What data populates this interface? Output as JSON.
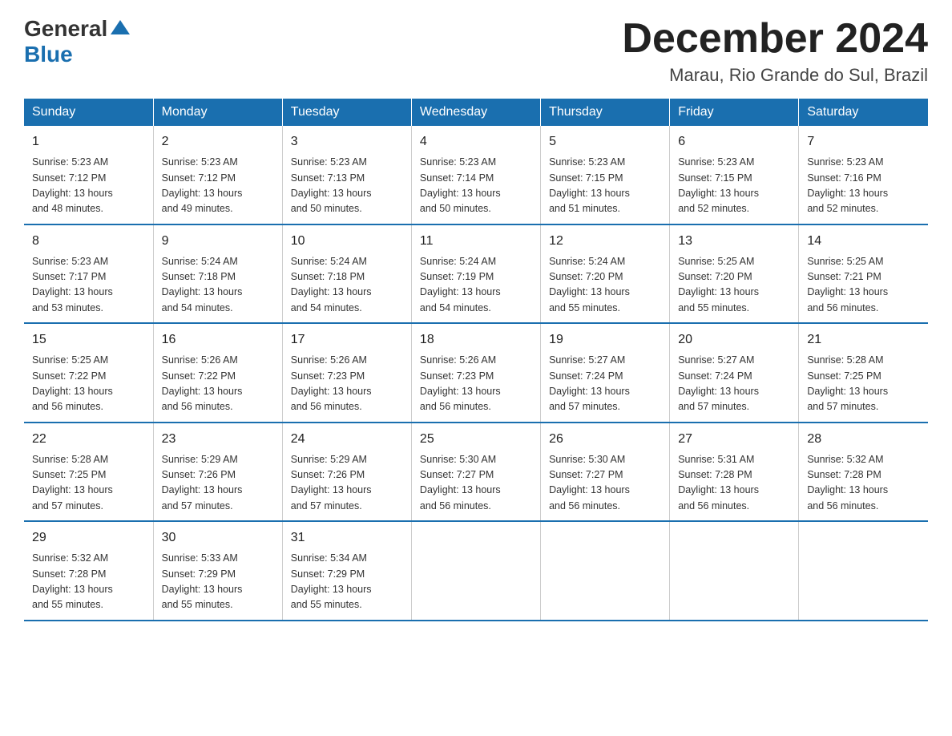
{
  "header": {
    "logo_general": "General",
    "logo_blue": "Blue",
    "month_title": "December 2024",
    "location": "Marau, Rio Grande do Sul, Brazil"
  },
  "weekdays": [
    "Sunday",
    "Monday",
    "Tuesday",
    "Wednesday",
    "Thursday",
    "Friday",
    "Saturday"
  ],
  "weeks": [
    [
      {
        "day": "1",
        "sunrise": "5:23 AM",
        "sunset": "7:12 PM",
        "daylight": "13 hours and 48 minutes."
      },
      {
        "day": "2",
        "sunrise": "5:23 AM",
        "sunset": "7:12 PM",
        "daylight": "13 hours and 49 minutes."
      },
      {
        "day": "3",
        "sunrise": "5:23 AM",
        "sunset": "7:13 PM",
        "daylight": "13 hours and 50 minutes."
      },
      {
        "day": "4",
        "sunrise": "5:23 AM",
        "sunset": "7:14 PM",
        "daylight": "13 hours and 50 minutes."
      },
      {
        "day": "5",
        "sunrise": "5:23 AM",
        "sunset": "7:15 PM",
        "daylight": "13 hours and 51 minutes."
      },
      {
        "day": "6",
        "sunrise": "5:23 AM",
        "sunset": "7:15 PM",
        "daylight": "13 hours and 52 minutes."
      },
      {
        "day": "7",
        "sunrise": "5:23 AM",
        "sunset": "7:16 PM",
        "daylight": "13 hours and 52 minutes."
      }
    ],
    [
      {
        "day": "8",
        "sunrise": "5:23 AM",
        "sunset": "7:17 PM",
        "daylight": "13 hours and 53 minutes."
      },
      {
        "day": "9",
        "sunrise": "5:24 AM",
        "sunset": "7:18 PM",
        "daylight": "13 hours and 54 minutes."
      },
      {
        "day": "10",
        "sunrise": "5:24 AM",
        "sunset": "7:18 PM",
        "daylight": "13 hours and 54 minutes."
      },
      {
        "day": "11",
        "sunrise": "5:24 AM",
        "sunset": "7:19 PM",
        "daylight": "13 hours and 54 minutes."
      },
      {
        "day": "12",
        "sunrise": "5:24 AM",
        "sunset": "7:20 PM",
        "daylight": "13 hours and 55 minutes."
      },
      {
        "day": "13",
        "sunrise": "5:25 AM",
        "sunset": "7:20 PM",
        "daylight": "13 hours and 55 minutes."
      },
      {
        "day": "14",
        "sunrise": "5:25 AM",
        "sunset": "7:21 PM",
        "daylight": "13 hours and 56 minutes."
      }
    ],
    [
      {
        "day": "15",
        "sunrise": "5:25 AM",
        "sunset": "7:22 PM",
        "daylight": "13 hours and 56 minutes."
      },
      {
        "day": "16",
        "sunrise": "5:26 AM",
        "sunset": "7:22 PM",
        "daylight": "13 hours and 56 minutes."
      },
      {
        "day": "17",
        "sunrise": "5:26 AM",
        "sunset": "7:23 PM",
        "daylight": "13 hours and 56 minutes."
      },
      {
        "day": "18",
        "sunrise": "5:26 AM",
        "sunset": "7:23 PM",
        "daylight": "13 hours and 56 minutes."
      },
      {
        "day": "19",
        "sunrise": "5:27 AM",
        "sunset": "7:24 PM",
        "daylight": "13 hours and 57 minutes."
      },
      {
        "day": "20",
        "sunrise": "5:27 AM",
        "sunset": "7:24 PM",
        "daylight": "13 hours and 57 minutes."
      },
      {
        "day": "21",
        "sunrise": "5:28 AM",
        "sunset": "7:25 PM",
        "daylight": "13 hours and 57 minutes."
      }
    ],
    [
      {
        "day": "22",
        "sunrise": "5:28 AM",
        "sunset": "7:25 PM",
        "daylight": "13 hours and 57 minutes."
      },
      {
        "day": "23",
        "sunrise": "5:29 AM",
        "sunset": "7:26 PM",
        "daylight": "13 hours and 57 minutes."
      },
      {
        "day": "24",
        "sunrise": "5:29 AM",
        "sunset": "7:26 PM",
        "daylight": "13 hours and 57 minutes."
      },
      {
        "day": "25",
        "sunrise": "5:30 AM",
        "sunset": "7:27 PM",
        "daylight": "13 hours and 56 minutes."
      },
      {
        "day": "26",
        "sunrise": "5:30 AM",
        "sunset": "7:27 PM",
        "daylight": "13 hours and 56 minutes."
      },
      {
        "day": "27",
        "sunrise": "5:31 AM",
        "sunset": "7:28 PM",
        "daylight": "13 hours and 56 minutes."
      },
      {
        "day": "28",
        "sunrise": "5:32 AM",
        "sunset": "7:28 PM",
        "daylight": "13 hours and 56 minutes."
      }
    ],
    [
      {
        "day": "29",
        "sunrise": "5:32 AM",
        "sunset": "7:28 PM",
        "daylight": "13 hours and 55 minutes."
      },
      {
        "day": "30",
        "sunrise": "5:33 AM",
        "sunset": "7:29 PM",
        "daylight": "13 hours and 55 minutes."
      },
      {
        "day": "31",
        "sunrise": "5:34 AM",
        "sunset": "7:29 PM",
        "daylight": "13 hours and 55 minutes."
      },
      null,
      null,
      null,
      null
    ]
  ]
}
